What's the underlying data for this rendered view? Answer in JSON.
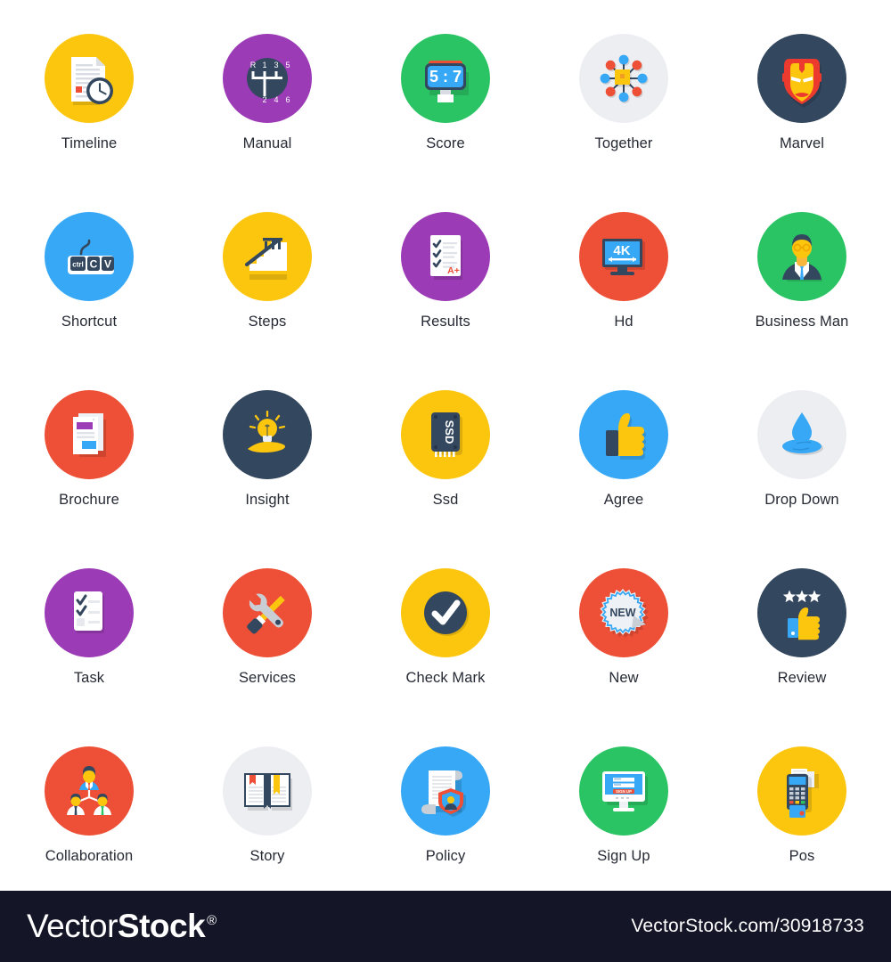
{
  "page": {
    "background": "#ffffff",
    "columns": 5,
    "rows": 5
  },
  "icons": [
    {
      "id": "timeline",
      "label": "Timeline",
      "disc_color": "#fcc60e",
      "glyph": "document-clock-icon"
    },
    {
      "id": "manual",
      "label": "Manual",
      "disc_color": "#9b3bb5",
      "glyph": "gear-stick-icon",
      "gears_top": [
        "R",
        "1",
        "3",
        "5"
      ],
      "gears_bottom": [
        "2",
        "4",
        "6"
      ]
    },
    {
      "id": "score",
      "label": "Score",
      "disc_color": "#2bc464",
      "glyph": "scoreboard-icon",
      "score_text": "5 : 7"
    },
    {
      "id": "together",
      "label": "Together",
      "disc_color": "#eceef2",
      "glyph": "network-nodes-icon"
    },
    {
      "id": "marvel",
      "label": "Marvel",
      "disc_color": "#33475f",
      "glyph": "iron-man-mask-icon"
    },
    {
      "id": "shortcut",
      "label": "Shortcut",
      "disc_color": "#37a8f5",
      "glyph": "keyboard-keys-icon",
      "keys": [
        "ctrl",
        "C",
        "V"
      ]
    },
    {
      "id": "steps",
      "label": "Steps",
      "disc_color": "#fcc60e",
      "glyph": "stairs-icon"
    },
    {
      "id": "results",
      "label": "Results",
      "disc_color": "#9b3bb5",
      "glyph": "graded-paper-icon",
      "grade": "A+"
    },
    {
      "id": "hd",
      "label": "Hd",
      "disc_color": "#ed4f37",
      "glyph": "monitor-4k-icon",
      "screen_text": "4K"
    },
    {
      "id": "business-man",
      "label": "Business Man",
      "disc_color": "#2bc464",
      "glyph": "businessman-avatar-icon"
    },
    {
      "id": "brochure",
      "label": "Brochure",
      "disc_color": "#ed4f37",
      "glyph": "brochure-pages-icon"
    },
    {
      "id": "insight",
      "label": "Insight",
      "disc_color": "#33475f",
      "glyph": "hand-bulb-icon"
    },
    {
      "id": "ssd",
      "label": "Ssd",
      "disc_color": "#fcc60e",
      "glyph": "ssd-chip-icon",
      "chip_text": "SSD"
    },
    {
      "id": "agree",
      "label": "Agree",
      "disc_color": "#37a8f5",
      "glyph": "thumbs-up-icon"
    },
    {
      "id": "drop-down",
      "label": "Drop Down",
      "disc_color": "#eceef2",
      "glyph": "water-drop-icon"
    },
    {
      "id": "task",
      "label": "Task",
      "disc_color": "#9b3bb5",
      "glyph": "checklist-icon"
    },
    {
      "id": "services",
      "label": "Services",
      "disc_color": "#ed4f37",
      "glyph": "wrench-screwdriver-icon"
    },
    {
      "id": "check-mark",
      "label": "Check Mark",
      "disc_color": "#fcc60e",
      "glyph": "check-circle-icon"
    },
    {
      "id": "new",
      "label": "New",
      "disc_color": "#ed4f37",
      "glyph": "new-sticker-icon",
      "sticker_text": "NEW"
    },
    {
      "id": "review",
      "label": "Review",
      "disc_color": "#33475f",
      "glyph": "stars-thumb-icon",
      "stars": 3
    },
    {
      "id": "collaboration",
      "label": "Collaboration",
      "disc_color": "#ed4f37",
      "glyph": "team-hierarchy-icon"
    },
    {
      "id": "story",
      "label": "Story",
      "disc_color": "#eceef2",
      "glyph": "open-book-icon"
    },
    {
      "id": "policy",
      "label": "Policy",
      "disc_color": "#37a8f5",
      "glyph": "scroll-shield-icon"
    },
    {
      "id": "sign-up",
      "label": "Sign Up",
      "disc_color": "#2bc464",
      "glyph": "signup-monitor-icon",
      "button_text": "SIGN UP"
    },
    {
      "id": "pos",
      "label": "Pos",
      "disc_color": "#fcc60e",
      "glyph": "pos-terminal-icon"
    }
  ],
  "footer": {
    "background": "#141527",
    "brand_light": "Vector",
    "brand_bold": "Stock",
    "brand_registered": "®",
    "url": "VectorStock.com/30918733"
  }
}
